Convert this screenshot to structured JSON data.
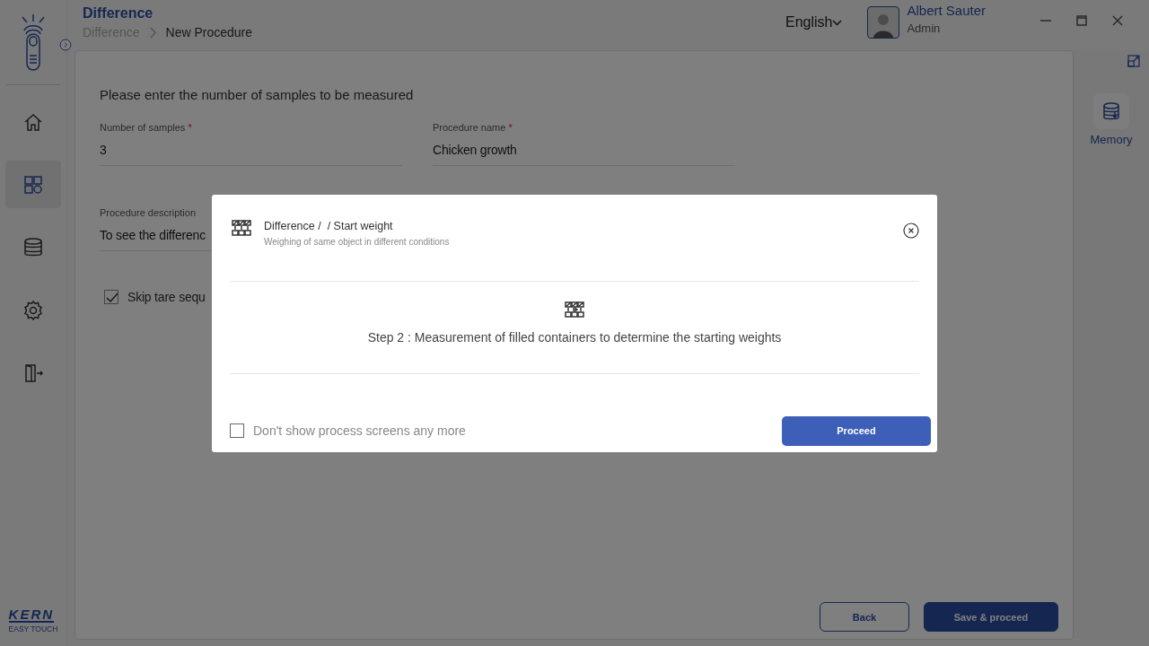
{
  "window": {
    "title": "Difference",
    "breadcrumb": [
      {
        "label": "Difference",
        "current": false
      },
      {
        "label": "New Procedure",
        "current": true
      }
    ]
  },
  "language": {
    "label": "English"
  },
  "user": {
    "name": "Albert Sauter",
    "role": "Admin"
  },
  "sidebar": {
    "items": [
      {
        "kind": "home",
        "selected": false
      },
      {
        "kind": "apps",
        "selected": true
      },
      {
        "kind": "database",
        "selected": false
      },
      {
        "kind": "settings",
        "selected": false
      },
      {
        "kind": "exit",
        "selected": false
      }
    ],
    "brand": "KERN",
    "tagline": "EASY TOUCH"
  },
  "form": {
    "heading": "Please enter the number of samples to be measured",
    "fields": [
      {
        "label": "Number of samples",
        "required_mark": "*",
        "value": "3"
      },
      {
        "label": "Procedure name",
        "required_mark": "*",
        "value": "Chicken growth"
      },
      {
        "label": "Procedure description",
        "value": "To see the differenc"
      }
    ],
    "checkbox": {
      "label": "Skip tare sequ",
      "checked": true
    },
    "buttons": [
      {
        "label": "Back",
        "kind": "secondary"
      },
      {
        "label": "Save & proceed",
        "kind": "primary"
      }
    ]
  },
  "right_panel": {
    "memory": "Memory"
  },
  "dialog": {
    "title": "Difference /  / Start weight",
    "subtitle": "Weighing of same object in different conditions",
    "step": "Step 2 : Measurement of filled containers to determine the starting weights",
    "checkbox": {
      "label": "Don't show process screens any more",
      "checked": false
    },
    "button": "Proceed"
  }
}
